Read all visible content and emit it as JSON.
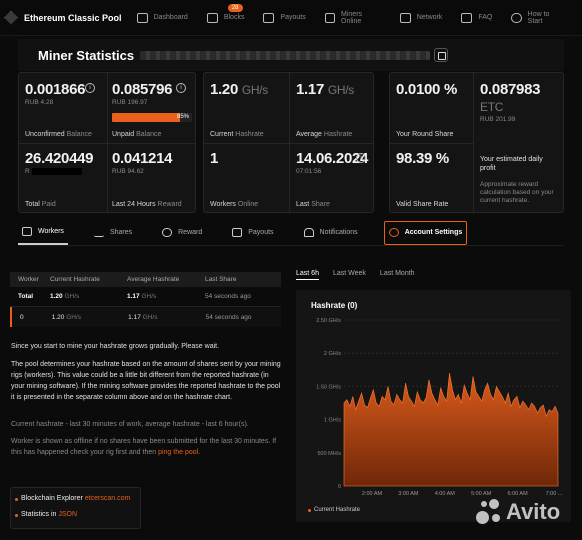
{
  "app": {
    "name": "Ethereum Classic Pool"
  },
  "nav": [
    {
      "label": "Dashboard",
      "icon": "home-icon"
    },
    {
      "label": "Blocks",
      "icon": "blocks-icon",
      "badge": "28"
    },
    {
      "label": "Payouts",
      "icon": "payouts-icon"
    },
    {
      "label": "Miners Online",
      "icon": "users-icon"
    },
    {
      "label": "Network",
      "icon": "monitor-icon"
    },
    {
      "label": "FAQ",
      "icon": "faq-icon"
    },
    {
      "label": "How to Start",
      "icon": "help-icon"
    }
  ],
  "header": {
    "title": "Miner Statistics"
  },
  "stats": {
    "unconfirmed": {
      "value": "0.001866",
      "sub": "RUB 4.28",
      "label": "Unconfirmed",
      "label_muted": "Balance"
    },
    "unpaid": {
      "value": "0.085796",
      "sub": "RUB 196.97",
      "progress_text": "85%",
      "progress": 0.85,
      "label": "Unpaid",
      "label_muted": "Balance"
    },
    "total_paid": {
      "value": "26.420449",
      "sub": "R",
      "label": "Total",
      "label_muted": "Paid"
    },
    "last24": {
      "value": "0.041214",
      "sub": "RUB 94.62",
      "label": "Last 24 Hours",
      "label_muted": "Reward"
    },
    "current_hr": {
      "value": "1.20",
      "unit": "GH/s",
      "label": "Current",
      "label_muted": "Hashrate"
    },
    "average_hr": {
      "value": "1.17",
      "unit": "GH/s",
      "label": "Average",
      "label_muted": "Hashrate"
    },
    "workers": {
      "value": "1",
      "label": "Workers",
      "label_muted": "Online"
    },
    "last_share": {
      "value": "14.06.2024",
      "sub": "07:01:56",
      "label": "Last",
      "label_muted": "Share"
    },
    "round_share": {
      "value": "0.0100 %",
      "label": "Your Round Share"
    },
    "est_profit": {
      "value": "0.087983",
      "unit": "ETC",
      "sub": "RUB 201.99",
      "label": "Your estimated daily profit",
      "note": "Approximate reward calculation based on your current hashrate."
    },
    "valid_rate": {
      "value": "98.39 %",
      "label": "Valid Share Rate"
    }
  },
  "tabs": [
    {
      "label": "Workers",
      "icon": "layers-icon"
    },
    {
      "label": "Shares",
      "icon": "pulse-icon"
    },
    {
      "label": "Reward",
      "icon": "toggle-icon"
    },
    {
      "label": "Payouts",
      "icon": "payouts-icon"
    },
    {
      "label": "Notifications",
      "icon": "bell-icon"
    },
    {
      "label": "Account Settings",
      "icon": "gear-icon"
    }
  ],
  "workers_table": {
    "headers": [
      "Worker",
      "Current Hashrate",
      "Average Hashrate",
      "Last Share"
    ],
    "rows": [
      {
        "worker": "Total",
        "current": "1.20",
        "current_unit": "GH/s",
        "average": "1.17",
        "average_unit": "GH/s",
        "last": "54 seconds ago"
      },
      {
        "worker": "0",
        "current": "1.20",
        "current_unit": "GH/s",
        "average": "1.17",
        "average_unit": "GH/s",
        "last": "54 seconds ago"
      }
    ]
  },
  "info": {
    "p1": "Since you start to mine your hashrate grows gradually. Please wait.",
    "p2": "The pool determines your hashrate based on the amount of shares sent by your mining rigs (workers). This value could be a little bit different from the reported hashrate (in your mining software). If the mining software provides the reported hashrate to the pool it is presented in the separate column above and on the hashrate chart.",
    "p3": "Current hashrate - last 30 minutes of work, average hashrate - last 6 hour(s).",
    "p4_start": "Worker is shown as offline if no shares have been submitted for the last 30 minutes. If this has happened check your rig first and then ",
    "p4_link": "ping the pool",
    "p4_end": "."
  },
  "links": {
    "explorer_label": "Blockchain Explorer",
    "explorer_link": "etcerscan.com",
    "stats_label": "Statistics in",
    "stats_link": "JSON"
  },
  "chart_range": [
    "Last 6h",
    "Last Week",
    "Last Month"
  ],
  "chart_data": {
    "type": "area",
    "title": "Hashrate (0)",
    "y_ticks": [
      "2.50 GH/s",
      "2 GH/s",
      "1.50 GH/s",
      "1 GH/s",
      "500 MH/s",
      "0"
    ],
    "x_ticks": [
      "2:00 AM",
      "3:00 AM",
      "4:00 AM",
      "5:00 AM",
      "6:00 AM",
      "7:00 ..."
    ],
    "ylim": [
      0,
      2.5
    ],
    "series": [
      {
        "name": "Current Hashrate",
        "color": "#e8601c",
        "values": [
          1.25,
          1.3,
          1.2,
          1.35,
          1.15,
          1.28,
          1.4,
          1.22,
          1.18,
          1.32,
          1.45,
          1.25,
          1.2,
          1.35,
          1.3,
          1.5,
          1.28,
          1.22,
          1.38,
          1.3,
          1.25,
          1.55,
          1.35,
          1.28,
          1.2,
          1.42,
          1.3,
          1.25,
          1.33,
          1.6,
          1.4,
          1.3,
          1.22,
          1.48,
          1.35,
          1.28,
          1.7,
          1.45,
          1.3,
          1.38,
          1.25,
          1.52,
          1.4,
          1.3,
          1.65,
          1.42,
          1.35,
          1.28,
          1.45,
          1.55,
          1.38,
          1.3,
          1.5,
          1.42,
          1.35,
          1.25,
          1.4,
          1.2,
          1.3,
          1.35,
          1.18,
          1.28,
          1.22,
          1.15,
          1.25,
          1.2,
          1.1,
          1.18,
          1.22,
          1.05,
          1.15,
          1.12,
          1.2,
          1.1
        ]
      }
    ]
  },
  "watermark": "Avito"
}
